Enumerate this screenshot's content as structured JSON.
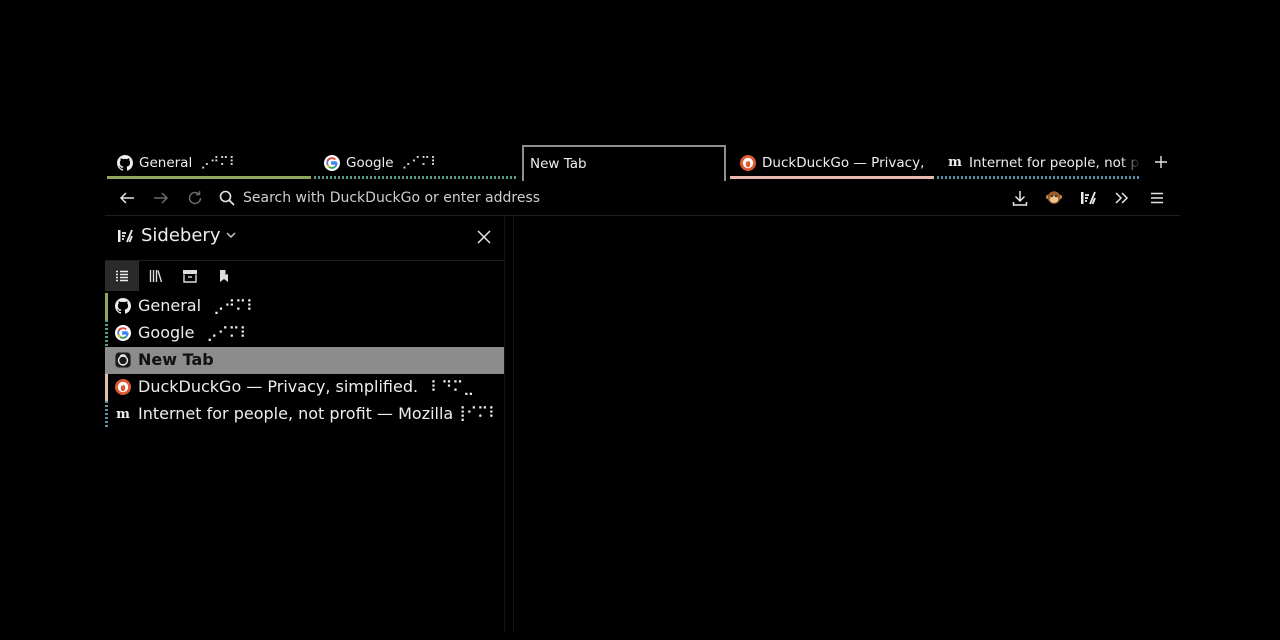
{
  "tabs": [
    {
      "label": "General",
      "braille": "⡠⠚⠍⠇",
      "favicon": "github-icon",
      "line_color": "#8fa85f",
      "line_style": "solid"
    },
    {
      "label": "Google",
      "braille": "⡠⠊⠍⠇",
      "favicon": "google-icon",
      "line_color": "#5b9a86",
      "line_style": "dotted"
    },
    {
      "label": "New Tab",
      "braille": "",
      "favicon": "",
      "active": true
    },
    {
      "label": "DuckDuckGo — Privacy, ",
      "braille": "",
      "favicon": "duckduckgo-icon",
      "line_color": "#e8b9b0",
      "line_style": "solid"
    },
    {
      "label": "Internet for people, not p",
      "braille": "",
      "favicon": "mozilla-icon",
      "line_color": "#5c8fa6",
      "line_style": "dotted"
    }
  ],
  "toolbar": {
    "url_placeholder": "Search with DuckDuckGo or enter address",
    "icons": [
      "back-arrow-icon",
      "forward-arrow-icon",
      "reload-icon",
      "search-icon",
      "download-icon",
      "monkey-extension-icon",
      "sidebery-icon",
      "overflow-chevrons-icon",
      "hamburger-menu-icon"
    ]
  },
  "sidebar": {
    "title": "Sidebery",
    "nav_icons": [
      "tab-list-icon",
      "library-icon",
      "archive-icon",
      "bookmark-icon"
    ],
    "tabs": [
      {
        "label": "General",
        "braille": "⡠⠚⠍⠇",
        "favicon": "github-icon",
        "mark_color": "#8fa85f",
        "mark_style": "solid"
      },
      {
        "label": "Google",
        "braille": "⡠⠊⠍⠇",
        "favicon": "google-icon",
        "mark_color": "#5b9a86",
        "mark_style": "dotted"
      },
      {
        "label": "New Tab",
        "braille": "",
        "favicon": "firefox-newtab-icon",
        "active": true
      },
      {
        "label": "DuckDuckGo — Privacy, simplified.",
        "braille": "⠇⠙⠍⣀",
        "favicon": "duckduckgo-icon",
        "mark_color": "#e8b9b0",
        "mark_style": "solid"
      },
      {
        "label": "Internet for people, not profit — Mozilla",
        "braille": "⢸⠊⠍⠇",
        "favicon": "mozilla-icon",
        "mark_color": "#5c8fa6",
        "mark_style": "dotted"
      }
    ]
  },
  "colors": {
    "background": "#000000",
    "active_row": "#8c8c8c",
    "active_tab_border": "#8f8f8f"
  }
}
